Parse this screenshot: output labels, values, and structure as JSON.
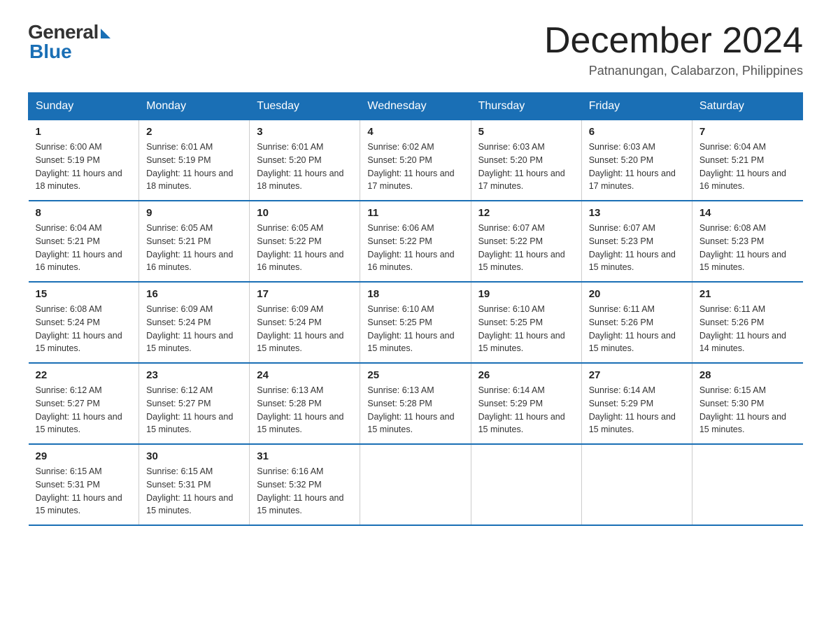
{
  "logo": {
    "general": "General",
    "blue": "Blue"
  },
  "title": "December 2024",
  "location": "Patnanungan, Calabarzon, Philippines",
  "weekdays": [
    "Sunday",
    "Monday",
    "Tuesday",
    "Wednesday",
    "Thursday",
    "Friday",
    "Saturday"
  ],
  "weeks": [
    [
      {
        "day": "1",
        "sunrise": "6:00 AM",
        "sunset": "5:19 PM",
        "daylight": "11 hours and 18 minutes."
      },
      {
        "day": "2",
        "sunrise": "6:01 AM",
        "sunset": "5:19 PM",
        "daylight": "11 hours and 18 minutes."
      },
      {
        "day": "3",
        "sunrise": "6:01 AM",
        "sunset": "5:20 PM",
        "daylight": "11 hours and 18 minutes."
      },
      {
        "day": "4",
        "sunrise": "6:02 AM",
        "sunset": "5:20 PM",
        "daylight": "11 hours and 17 minutes."
      },
      {
        "day": "5",
        "sunrise": "6:03 AM",
        "sunset": "5:20 PM",
        "daylight": "11 hours and 17 minutes."
      },
      {
        "day": "6",
        "sunrise": "6:03 AM",
        "sunset": "5:20 PM",
        "daylight": "11 hours and 17 minutes."
      },
      {
        "day": "7",
        "sunrise": "6:04 AM",
        "sunset": "5:21 PM",
        "daylight": "11 hours and 16 minutes."
      }
    ],
    [
      {
        "day": "8",
        "sunrise": "6:04 AM",
        "sunset": "5:21 PM",
        "daylight": "11 hours and 16 minutes."
      },
      {
        "day": "9",
        "sunrise": "6:05 AM",
        "sunset": "5:21 PM",
        "daylight": "11 hours and 16 minutes."
      },
      {
        "day": "10",
        "sunrise": "6:05 AM",
        "sunset": "5:22 PM",
        "daylight": "11 hours and 16 minutes."
      },
      {
        "day": "11",
        "sunrise": "6:06 AM",
        "sunset": "5:22 PM",
        "daylight": "11 hours and 16 minutes."
      },
      {
        "day": "12",
        "sunrise": "6:07 AM",
        "sunset": "5:22 PM",
        "daylight": "11 hours and 15 minutes."
      },
      {
        "day": "13",
        "sunrise": "6:07 AM",
        "sunset": "5:23 PM",
        "daylight": "11 hours and 15 minutes."
      },
      {
        "day": "14",
        "sunrise": "6:08 AM",
        "sunset": "5:23 PM",
        "daylight": "11 hours and 15 minutes."
      }
    ],
    [
      {
        "day": "15",
        "sunrise": "6:08 AM",
        "sunset": "5:24 PM",
        "daylight": "11 hours and 15 minutes."
      },
      {
        "day": "16",
        "sunrise": "6:09 AM",
        "sunset": "5:24 PM",
        "daylight": "11 hours and 15 minutes."
      },
      {
        "day": "17",
        "sunrise": "6:09 AM",
        "sunset": "5:24 PM",
        "daylight": "11 hours and 15 minutes."
      },
      {
        "day": "18",
        "sunrise": "6:10 AM",
        "sunset": "5:25 PM",
        "daylight": "11 hours and 15 minutes."
      },
      {
        "day": "19",
        "sunrise": "6:10 AM",
        "sunset": "5:25 PM",
        "daylight": "11 hours and 15 minutes."
      },
      {
        "day": "20",
        "sunrise": "6:11 AM",
        "sunset": "5:26 PM",
        "daylight": "11 hours and 15 minutes."
      },
      {
        "day": "21",
        "sunrise": "6:11 AM",
        "sunset": "5:26 PM",
        "daylight": "11 hours and 14 minutes."
      }
    ],
    [
      {
        "day": "22",
        "sunrise": "6:12 AM",
        "sunset": "5:27 PM",
        "daylight": "11 hours and 15 minutes."
      },
      {
        "day": "23",
        "sunrise": "6:12 AM",
        "sunset": "5:27 PM",
        "daylight": "11 hours and 15 minutes."
      },
      {
        "day": "24",
        "sunrise": "6:13 AM",
        "sunset": "5:28 PM",
        "daylight": "11 hours and 15 minutes."
      },
      {
        "day": "25",
        "sunrise": "6:13 AM",
        "sunset": "5:28 PM",
        "daylight": "11 hours and 15 minutes."
      },
      {
        "day": "26",
        "sunrise": "6:14 AM",
        "sunset": "5:29 PM",
        "daylight": "11 hours and 15 minutes."
      },
      {
        "day": "27",
        "sunrise": "6:14 AM",
        "sunset": "5:29 PM",
        "daylight": "11 hours and 15 minutes."
      },
      {
        "day": "28",
        "sunrise": "6:15 AM",
        "sunset": "5:30 PM",
        "daylight": "11 hours and 15 minutes."
      }
    ],
    [
      {
        "day": "29",
        "sunrise": "6:15 AM",
        "sunset": "5:31 PM",
        "daylight": "11 hours and 15 minutes."
      },
      {
        "day": "30",
        "sunrise": "6:15 AM",
        "sunset": "5:31 PM",
        "daylight": "11 hours and 15 minutes."
      },
      {
        "day": "31",
        "sunrise": "6:16 AM",
        "sunset": "5:32 PM",
        "daylight": "11 hours and 15 minutes."
      },
      null,
      null,
      null,
      null
    ]
  ],
  "labels": {
    "sunrise": "Sunrise:",
    "sunset": "Sunset:",
    "daylight": "Daylight:"
  }
}
